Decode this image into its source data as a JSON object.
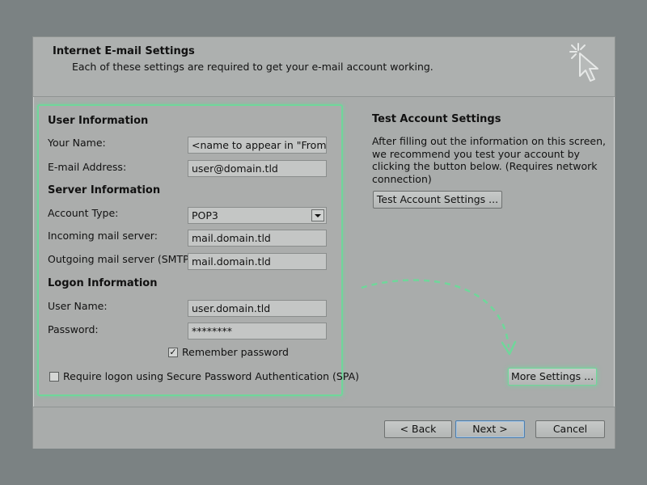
{
  "header": {
    "title": "Internet E-mail Settings",
    "subtitle": "Each of these settings are required to get your e-mail account working."
  },
  "user_info": {
    "title": "User Information",
    "your_name_label": "Your Name:",
    "your_name_value": "<name to appear in \"From\">",
    "email_label": "E-mail Address:",
    "email_value": "user@domain.tld"
  },
  "server_info": {
    "title": "Server Information",
    "account_type_label": "Account Type:",
    "account_type_value": "POP3",
    "incoming_label": "Incoming mail server:",
    "incoming_value": "mail.domain.tld",
    "outgoing_label": "Outgoing mail server (SMTP):",
    "outgoing_value": "mail.domain.tld"
  },
  "logon_info": {
    "title": "Logon Information",
    "user_name_label": "User Name:",
    "user_name_value": "user.domain.tld",
    "password_label": "Password:",
    "password_value": "********",
    "remember_label": "Remember password",
    "remember_checked": true,
    "spa_label": "Require logon using Secure Password Authentication (SPA)",
    "spa_checked": false
  },
  "test": {
    "title": "Test Account Settings",
    "description": "After filling out the information on this screen, we recommend you test your account by clicking the button below. (Requires network connection)",
    "button_label": "Test Account Settings ..."
  },
  "more_settings_label": "More Settings ...",
  "footer": {
    "back_label": "< Back",
    "next_label": "Next >",
    "cancel_label": "Cancel"
  },
  "colors": {
    "highlight": "#6fd79a",
    "background": "#7b8283",
    "dialog": "#a9acab"
  }
}
